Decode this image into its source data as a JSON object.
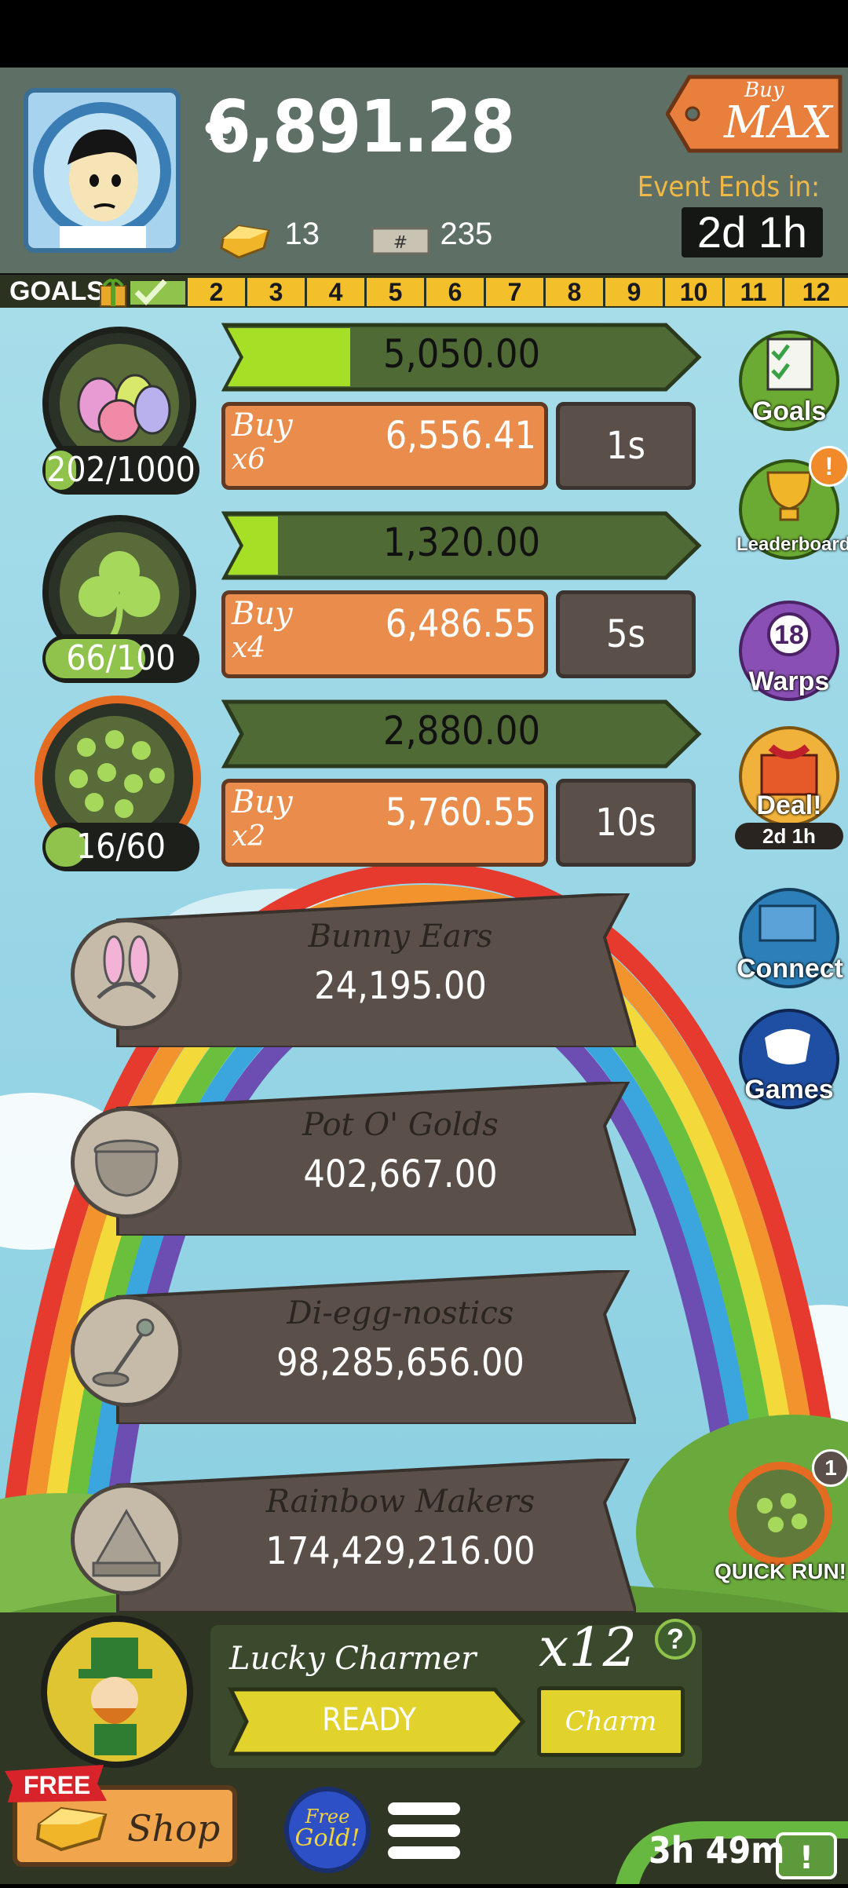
{
  "header": {
    "currency_value": "6,891.28",
    "gold_count": "13",
    "megabucks_count": "235",
    "buy_max_small": "Buy",
    "buy_max_big": "MAX",
    "event_label": "Event Ends in:",
    "event_timer": "2d 1h"
  },
  "goals_bar": {
    "label": "GOALS",
    "cells": [
      "2",
      "3",
      "4",
      "5",
      "6",
      "7",
      "8",
      "9",
      "10",
      "11",
      "12"
    ]
  },
  "rows": [
    {
      "count": "202/1000",
      "count_fraction": 0.202,
      "progress_value": "5,050.00",
      "progress_fraction": 0.27,
      "buy_label": "Buy",
      "buy_mult": "x6",
      "buy_price": "6,556.41",
      "time": "1s"
    },
    {
      "count": "66/100",
      "count_fraction": 0.66,
      "progress_value": "1,320.00",
      "progress_fraction": 0.12,
      "buy_label": "Buy",
      "buy_mult": "x4",
      "buy_price": "6,486.55",
      "time": "5s"
    },
    {
      "count": "16/60",
      "count_fraction": 0.27,
      "progress_value": "2,880.00",
      "progress_fraction": 0.0,
      "buy_label": "Buy",
      "buy_mult": "x2",
      "buy_price": "5,760.55",
      "time": "10s"
    }
  ],
  "managers": [
    {
      "name": "Bunny Ears",
      "value": "24,195.00"
    },
    {
      "name": "Pot O' Golds",
      "value": "402,667.00"
    },
    {
      "name": "Di-egg-nostics",
      "value": "98,285,656.00"
    },
    {
      "name": "Rainbow Makers",
      "value": "174,429,216.00"
    }
  ],
  "side_buttons": {
    "goals": "Goals",
    "leaderboard": "Leaderboard",
    "warps": "Warps",
    "warps_count": "18",
    "deal": "Deal!",
    "deal_timer": "2d 1h",
    "connect": "Connect",
    "games": "Games",
    "quick_run": "QUICK RUN!",
    "quick_run_badge": "1"
  },
  "bottom": {
    "charm_name": "Lucky Charmer",
    "charm_mult": "x12",
    "ready_label": "READY",
    "charm_button": "Charm",
    "help": "?",
    "free_tag": "FREE",
    "shop_label": "Shop",
    "free_gold_line1": "Free",
    "free_gold_line2": "Gold!",
    "timer": "3h 49m"
  },
  "colors": {
    "accent_orange": "#ea8c4b",
    "progress_green": "#4f6a34",
    "progress_fill": "#a6e026",
    "header_bg": "#5e7066",
    "goals_yellow": "#f3c02c"
  }
}
